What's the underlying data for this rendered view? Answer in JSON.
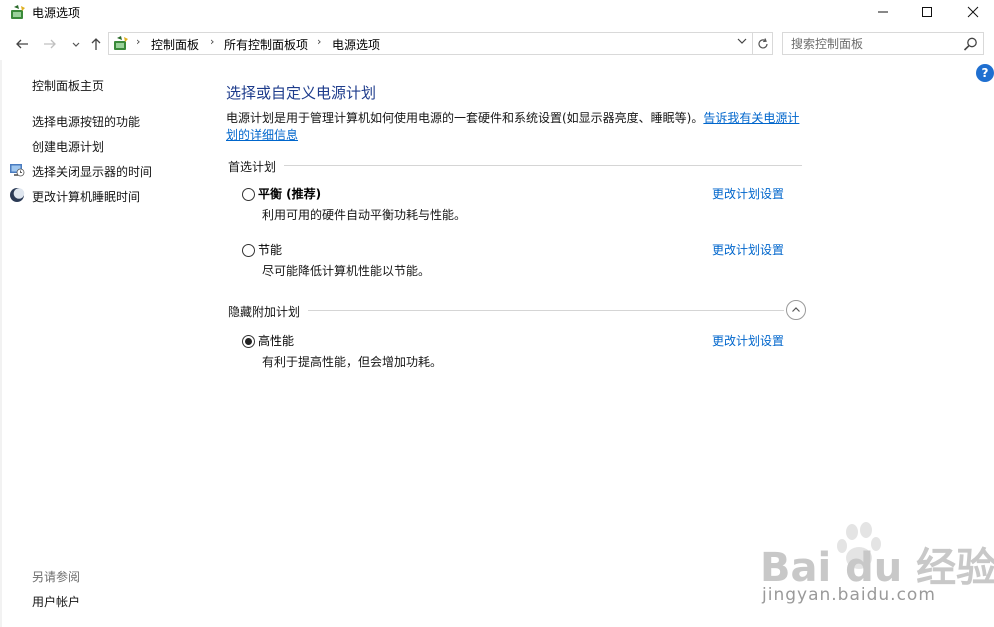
{
  "window": {
    "title": "电源选项"
  },
  "nav": {
    "breadcrumbs": [
      "控制面板",
      "所有控制面板项",
      "电源选项"
    ],
    "search_placeholder": "搜索控制面板"
  },
  "sidebar": {
    "home": "控制面板主页",
    "items": [
      {
        "label": "选择电源按钮的功能",
        "icon": ""
      },
      {
        "label": "创建电源计划",
        "icon": ""
      },
      {
        "label": "选择关闭显示器的时间",
        "icon": "monitor-clock-icon"
      },
      {
        "label": "更改计算机睡眠时间",
        "icon": "moon-icon"
      }
    ],
    "see_also": "另请参阅",
    "see_also_items": [
      "用户帐户"
    ]
  },
  "main": {
    "title": "选择或自定义电源计划",
    "description": "电源计划是用于管理计算机如何使用电源的一套硬件和系统设置(如显示器亮度、睡眠等)。",
    "description_link": "告诉我有关电源计划的详细信息",
    "preferred_group": "首选计划",
    "hidden_group": "隐藏附加计划",
    "plans": [
      {
        "name": "平衡 (推荐)",
        "desc": "利用可用的硬件自动平衡功耗与性能。",
        "link": "更改计划设置",
        "selected": false
      },
      {
        "name": "节能",
        "desc": "尽可能降低计算机性能以节能。",
        "link": "更改计划设置",
        "selected": false
      },
      {
        "name": "高性能",
        "desc": "有利于提高性能，但会增加功耗。",
        "link": "更改计划设置",
        "selected": true
      }
    ]
  },
  "watermark": {
    "brand": "Bai du 经验",
    "url": "jingyan.baidu.com"
  },
  "colors": {
    "link": "#0066cc",
    "title": "#1e3c8c",
    "help": "#1f6fd0"
  }
}
